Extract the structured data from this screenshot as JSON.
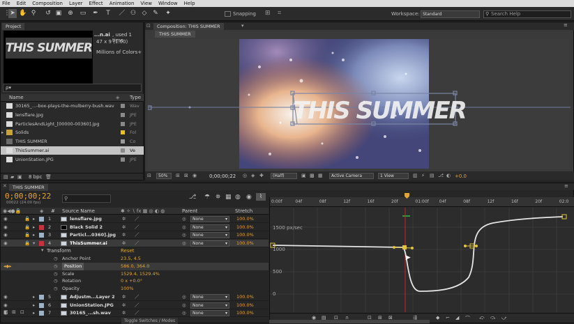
{
  "menu": [
    "File",
    "Edit",
    "Composition",
    "Layer",
    "Effect",
    "Animation",
    "View",
    "Window",
    "Help"
  ],
  "toolbar": {
    "snapping": "Snapping",
    "workspace_label": "Workspace:",
    "workspace_value": "Standard",
    "search_placeholder": "Search Help"
  },
  "project": {
    "tab": "Project",
    "thumb_text": "THIS SUMMER",
    "info_name": "...n.ai",
    "info_used": ", used 1 time",
    "info_size": "47 x 9 (1.00)",
    "info_colors": "Millions of Colors+",
    "search_value": "ρ▾",
    "col_name": "Name",
    "col_type": "Type",
    "items": [
      {
        "name": "30165_...-box-plays-the-mulberry-bush.wav",
        "type": "Wav",
        "label_color": "#8a8a8a"
      },
      {
        "name": "lensflare.jpg",
        "type": "JPE",
        "label_color": "#8a8a8a"
      },
      {
        "name": "ParticlesAndLight_[00000-00360].jpg",
        "type": "JPE",
        "label_color": "#8a8a8a"
      },
      {
        "name": "Solids",
        "type": "Fol",
        "label_color": "#e6c419"
      },
      {
        "name": "THIS SUMMER",
        "type": "Co",
        "label_color": "#9a9a9a"
      },
      {
        "name": "ThisSummer.ai",
        "type": "Ve",
        "label_color": "#8a8a8a"
      },
      {
        "name": "UnionStation.JPG",
        "type": "JPE",
        "label_color": "#8a8a8a"
      }
    ],
    "bpc": "8 bpc"
  },
  "composition": {
    "tab": "Composition: THIS SUMMER",
    "subtab": "THIS SUMMER",
    "overlay_text": "THIS SUMMER",
    "zoom": "50%",
    "timecode": "0;00;00;22",
    "resolution": "(Half)",
    "camera": "Active Camera",
    "views": "1 View",
    "exposure": "+0.0"
  },
  "timeline": {
    "tab": "THIS SUMMER",
    "timecode": "0;00;00;22",
    "frames": "00022 (24.00 fps)",
    "col_source": "Source Name",
    "col_parent": "Parent",
    "col_stretch": "Stretch",
    "layers": [
      {
        "num": "1",
        "name": "lensflare.jpg",
        "color": "#9fb3c8",
        "parent": "None",
        "stretch": "100.0%"
      },
      {
        "num": "2",
        "name": "Black Solid 2",
        "color": "#c8323c",
        "parent": "None",
        "stretch": "100.0%"
      },
      {
        "num": "3",
        "name": "Particl...0360].jpg",
        "color": "#9fb3c8",
        "parent": "None",
        "stretch": "100.0%"
      },
      {
        "num": "4",
        "name": "ThisSummer.ai",
        "color": "#c8323c",
        "parent": "None",
        "stretch": "100.0%"
      }
    ],
    "transform_label": "Transform",
    "reset": "Reset",
    "props": [
      {
        "name": "Anchor Point",
        "value": "23.5, 4.5"
      },
      {
        "name": "Position",
        "value": "586.0, 364.0"
      },
      {
        "name": "Scale",
        "value": "1529.4, 1529.4%"
      },
      {
        "name": "Rotation",
        "value": "0 x +0.0°"
      },
      {
        "name": "Opacity",
        "value": "100%"
      }
    ],
    "layers_after": [
      {
        "num": "5",
        "name": "Adjustm...Layer 2",
        "color": "#9fb3c8",
        "parent": "None",
        "stretch": "100.0%"
      },
      {
        "num": "6",
        "name": "UnionStation.JPG",
        "color": "#9fb3c8",
        "parent": "None",
        "stretch": "100.0%"
      },
      {
        "num": "7",
        "name": "30165_...sh.wav",
        "color": "#9fb3c8",
        "parent": "None",
        "stretch": "100.0%"
      }
    ],
    "toggle": "Toggle Switches / Modes",
    "ruler": [
      "0:00f",
      "04f",
      "08f",
      "12f",
      "16f",
      "20f",
      "01:00f",
      "04f",
      "08f",
      "12f",
      "16f",
      "20f",
      "02:0"
    ],
    "graph_labels": [
      "1500 px/sec",
      "1000",
      "500",
      "0"
    ]
  },
  "colors": {
    "accent": "#e2a53a",
    "playhead": "#d22",
    "curve": "#e6e6e6"
  }
}
